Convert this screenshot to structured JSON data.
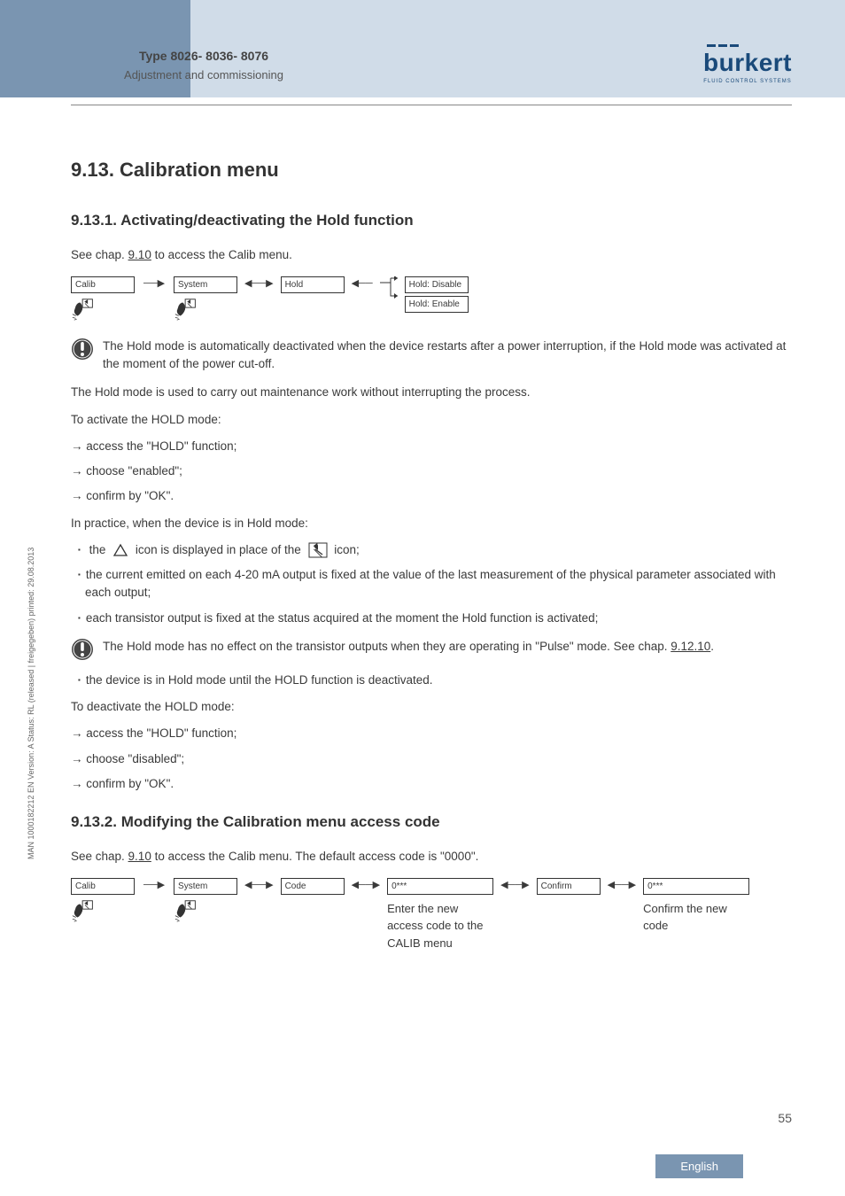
{
  "header": {
    "type_title": "Type 8026- 8036- 8076",
    "section": "Adjustment and commissioning",
    "logo_text": "burkert",
    "logo_subtitle": "FLUID CONTROL SYSTEMS"
  },
  "h1": "9.13.   Calibration menu",
  "s1": {
    "heading": "9.13.1.   Activating/deactivating the Hold function",
    "intro_pre": "See chap. ",
    "intro_link": "9.10",
    "intro_post": " to access the Calib menu.",
    "path": {
      "calib": "Calib",
      "system": "System",
      "hold": "Hold",
      "disable": "Hold: Disable",
      "enable": "Hold: Enable"
    },
    "callout1": "The Hold mode is automatically deactivated when the device restarts after a power interruption, if the Hold mode was activated at the moment of the power cut-off.",
    "p1": "The Hold mode is used to carry out maintenance work without interrupting the process.",
    "p2": "To activate the HOLD mode:",
    "a1": "→ access the \"HOLD\" function;",
    "a2": "→ choose \"enabled\";",
    "a3": "→ confirm by \"OK\".",
    "p3": "In practice, when the device is in Hold mode:",
    "b1_pre": "the ",
    "b1_mid": " icon is displayed in place of the ",
    "b1_post": " icon;",
    "b2": "the current emitted on each 4-20 mA output is fixed at the value of the last measurement of the physical parameter associated with each output;",
    "b3": "each transistor output is fixed at the status acquired at the moment the Hold function is activated;",
    "callout2_pre": "The Hold mode has no effect on the transistor outputs when they are operating in \"Pulse\" mode. See chap. ",
    "callout2_link": "9.12.10",
    "callout2_post": ".",
    "b4": "the device is in Hold mode until the HOLD function is deactivated.",
    "p4": "To deactivate the HOLD mode:",
    "a4": "→ access the \"HOLD\" function;",
    "a5": "→ choose \"disabled\";",
    "a6": "→ confirm by \"OK\"."
  },
  "s2": {
    "heading": "9.13.2.   Modifying the Calibration menu access code",
    "intro_pre": "See chap. ",
    "intro_link": "9.10",
    "intro_post": " to access the Calib menu. The default access code is \"0000\".",
    "path": {
      "calib": "Calib",
      "system": "System",
      "code": "Code",
      "entry1": "0***",
      "confirm": "Confirm",
      "entry2": "0***"
    },
    "cap1": "Enter the new access code to the CALIB menu",
    "cap2": "Confirm the new code"
  },
  "sidebar": "MAN 1000182212 EN Version: A Status: RL (released | freigegeben) printed: 29.08.2013",
  "page_num": "55",
  "lang": "English"
}
